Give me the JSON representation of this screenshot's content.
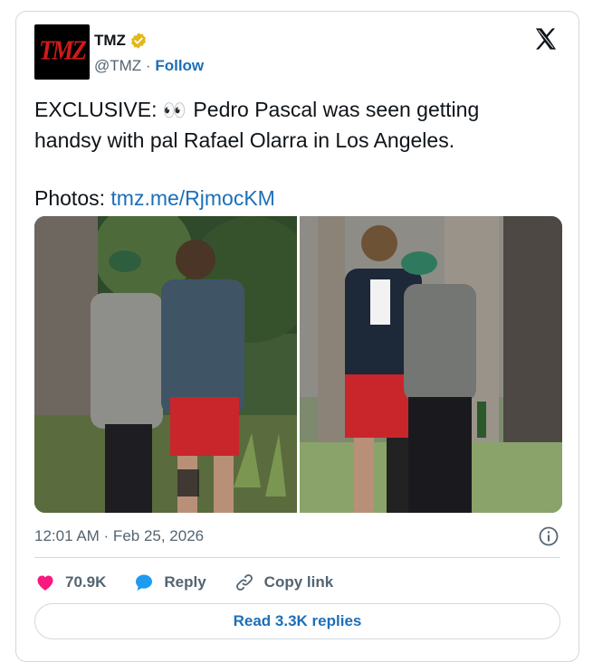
{
  "author": {
    "name": "TMZ",
    "handle": "@TMZ",
    "separator": "·",
    "follow_label": "Follow",
    "avatar_text": "TMZ",
    "verified_color": "#e2b719"
  },
  "tweet": {
    "line1_prefix": "EXCLUSIVE: ",
    "line1_eyes": "👀",
    "line1_suffix": " Pedro Pascal was seen getting",
    "line2": "handsy with pal Rafael Olarra in Los Angeles.",
    "photos_label": "Photos: ",
    "photos_link": "tmz.me/RjmocKM"
  },
  "meta": {
    "timestamp": "12:01 AM · Feb 25, 2026"
  },
  "actions": {
    "likes": "70.9K",
    "reply_label": "Reply",
    "copy_link_label": "Copy link"
  },
  "read_replies_label": "Read 3.3K replies",
  "colors": {
    "link": "#1d6fb8",
    "heart": "#f91880",
    "border": "#cfd9de",
    "muted": "#536471"
  }
}
